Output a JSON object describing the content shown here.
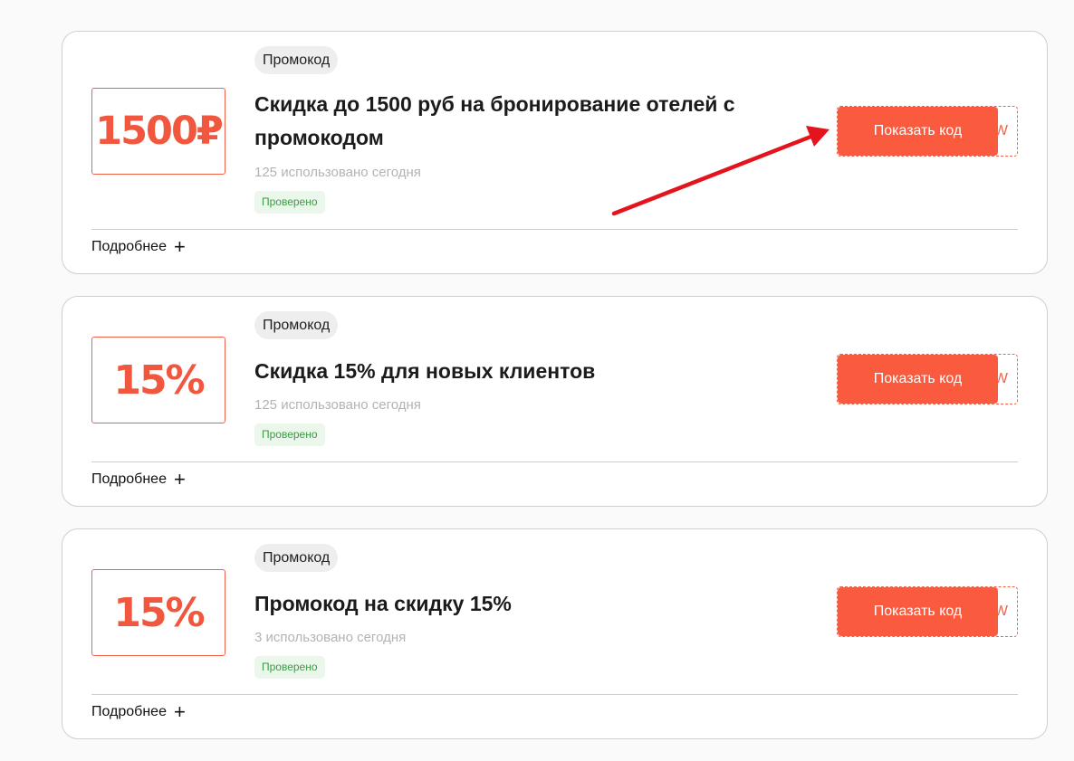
{
  "offers": [
    {
      "badge": "1500₽",
      "type_label": "Промокод",
      "title": "Скидка до 1500 руб на бронирование отелей с промокодом",
      "usage": "125 использовано сегодня",
      "verified": "Проверено",
      "button": "Показать код",
      "code_peek": "W",
      "more": "Подробнее"
    },
    {
      "badge": "15%",
      "type_label": "Промокод",
      "title": "Скидка 15% для новых клиентов",
      "usage": "125 использовано сегодня",
      "verified": "Проверено",
      "button": "Показать код",
      "code_peek": "W",
      "more": "Подробнее"
    },
    {
      "badge": "15%",
      "type_label": "Промокод",
      "title": "Промокод на скидку 15%",
      "usage": "3 использовано сегодня",
      "verified": "Проверено",
      "button": "Показать код",
      "code_peek": "W",
      "more": "Подробнее"
    }
  ],
  "colors": {
    "accent": "#fa5a3e",
    "verified_text": "#3d9a47",
    "annotation_arrow": "#e3141b"
  },
  "icons": {
    "plus": "plus-icon",
    "arrow": "annotation-arrow-icon"
  }
}
